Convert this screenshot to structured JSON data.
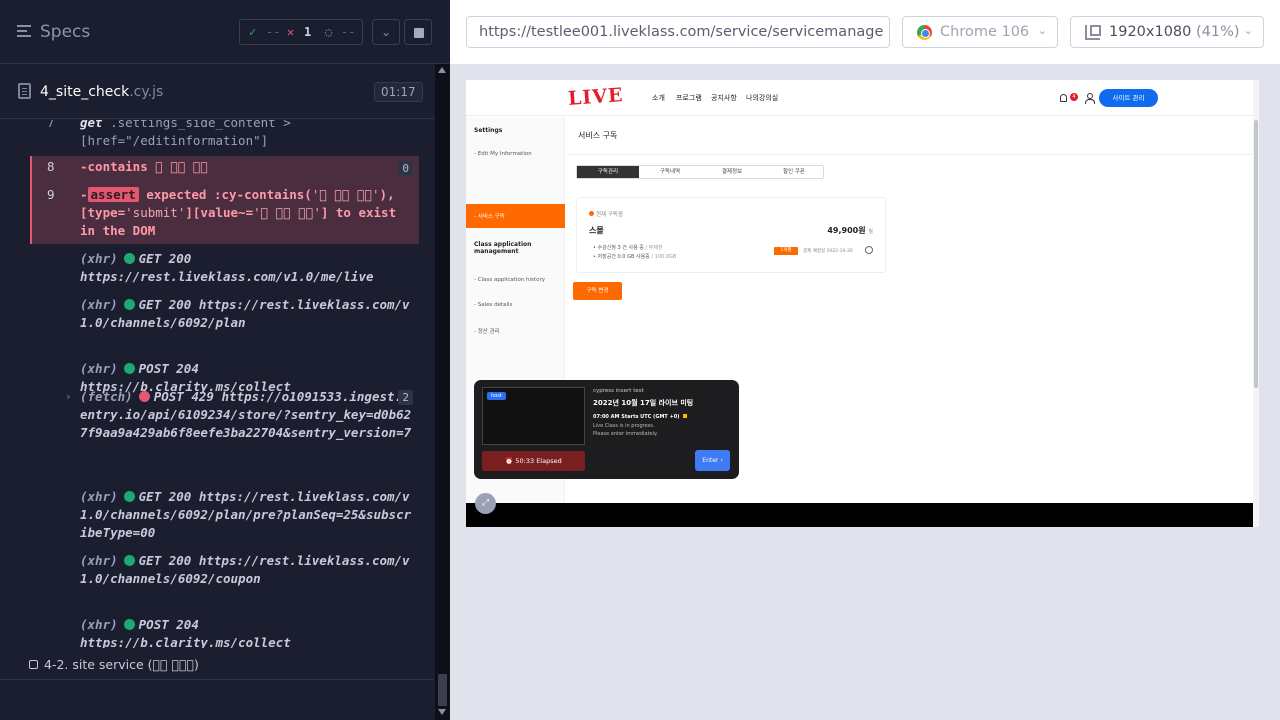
{
  "reporter": {
    "header": {
      "title": "Specs",
      "passed": "--",
      "failed": "1",
      "pending": "--"
    },
    "spec": {
      "name": "4_site_check",
      "ext": ".cy.js",
      "duration": "01:17"
    },
    "commands": {
      "c7": {
        "num": "7",
        "method": "get",
        "arg": ".settings_side_content > [href=\"/editinformation\"]"
      },
      "c8": {
        "num": "8",
        "method": "-contains",
        "arg": "\u0000 \u0000\u0000 \u0000\u0000",
        "count": "0"
      },
      "c9": {
        "num": "9",
        "prefix": "-",
        "badge": "assert",
        "t1": "expected",
        "t2": ":cy-contains(",
        "s1": "'\u0000 \u0000\u0000 \u0000\u0000'",
        "t3": "),",
        "t4": "[type=",
        "s2": "'submit'",
        "t5": "][value~=",
        "s3": "'\u0000 \u0000\u0000 \u0000\u0000'",
        "t6": "] to exist in the DOM"
      },
      "r1": {
        "kind": "(xhr)",
        "status": "GET 200",
        "url": "https://rest.liveklass.com/v1.0/me/live"
      },
      "r2": {
        "kind": "(xhr)",
        "status": "GET 200",
        "url": "https://rest.liveklass.com/v1.0/channels/6092/plan"
      },
      "r3": {
        "kind": "(xhr)",
        "status": "POST 204",
        "url": "https://b.clarity.ms/collect"
      },
      "r4": {
        "kind": "(fetch)",
        "status": "POST 429",
        "url": "https://o1091533.ingest.sentry.io/api/6109234/store/?sentry_key=d0b627f9aa9a429ab6f8eefe3ba22704&sentry_version=7",
        "count": "2"
      },
      "r5": {
        "kind": "(xhr)",
        "status": "GET 200",
        "url": "https://rest.liveklass.com/v1.0/channels/6092/plan/pre?planSeq=25&subscribeType=00"
      },
      "r6": {
        "kind": "(xhr)",
        "status": "GET 200",
        "url": "https://rest.liveklass.com/v1.0/channels/6092/coupon"
      },
      "r7": {
        "kind": "(xhr)",
        "status": "POST 204",
        "url": "https://b.clarity.ms/collect"
      }
    },
    "suite": "4-2. site service (\u0000\u0000 \u0000\u0000\u0000)"
  },
  "aut": {
    "url": "https://testlee001.liveklass.com/service/servicemanage",
    "browser": "Chrome 106",
    "viewport": "1920x1080",
    "viewport_pct": "(41%)",
    "site": {
      "logo": "LIVE",
      "nav": [
        "소개",
        "프로그램",
        "공지사항",
        "나의강의실"
      ],
      "noti_count": "4",
      "admin_button": "사이트 관리",
      "sidebar": {
        "settings": "Settings",
        "edit_info": "- Edit My Information",
        "service_sub": "- 서비스 구독",
        "class_app_mgmt": "Class application management",
        "class_app_history": "- Class application history",
        "sales_details": "- Sales details",
        "settlement": "- 정산 관리"
      },
      "page_title": "서비스 구독",
      "tabs": [
        "구독관리",
        "구독내역",
        "결제정보",
        "할인 쿠폰"
      ],
      "subscription": {
        "status": "현재 구독중",
        "plan": "스몰",
        "price": "49,900원",
        "price_unit": "월",
        "detail1": "수강신청 3 건 사용 중",
        "detail1_max": "/ 무제한",
        "detail2": "저장공간 0.0 GB 사용중",
        "detail2_max": "/ 100.0GB",
        "period_badge": "1개월",
        "next_pay": "결제 예정일 2022-10-30",
        "change_button": "구독 변경"
      },
      "live": {
        "host": "host",
        "subtitle": "cypress insert test",
        "title": "2022년 10월 17일 라이브 미팅",
        "time": "07:00 AM Starts UTC (GMT +0)",
        "msg1": "Live Class is in progress.",
        "msg2": "Please enter immediately.",
        "elapsed": "50:33 Elapsed",
        "enter": "Enter"
      }
    }
  },
  "colors": {
    "reporter_bg": "#1b1e2e",
    "fail_red": "#e45770",
    "pass_green": "#1fa971",
    "site_accent": "#ff6a00",
    "site_blue": "#0f6cf0"
  }
}
